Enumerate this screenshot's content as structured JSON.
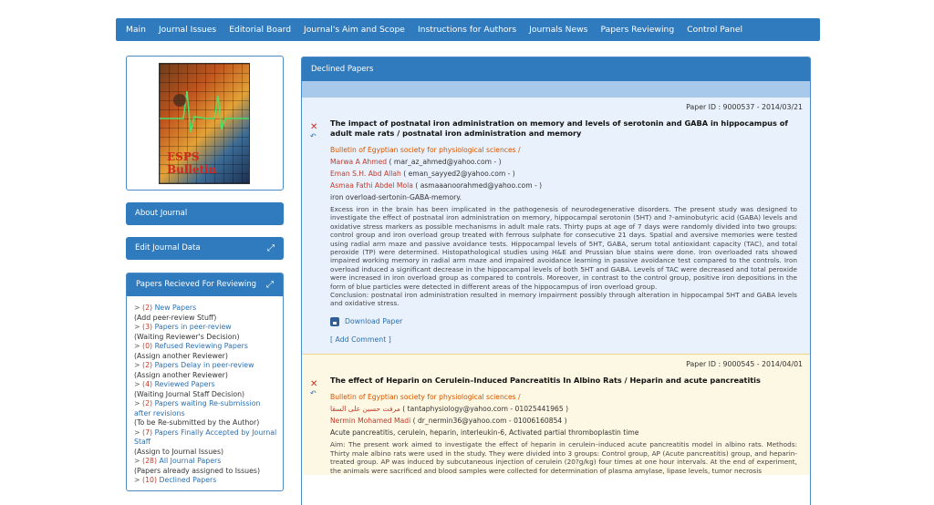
{
  "nav": {
    "items": [
      "Main",
      "Journal Issues",
      "Editorial Board",
      "Journal's Aim and Scope",
      "Instructions for Authors",
      "Journals News",
      "Papers Reviewing",
      "Control Panel"
    ]
  },
  "sidebar": {
    "logo_text": "ESPS Bulletin",
    "about": "About Journal",
    "edit": "Edit Journal Data",
    "panel_title": "Papers Recieved For Reviewing",
    "items": [
      {
        "arrow": ">",
        "count": "(2)",
        "label": "New Papers",
        "sub": "(Add peer-review Stuff)"
      },
      {
        "arrow": ">",
        "count": "(3)",
        "label": "Papers in peer-review",
        "sub": "(Waiting Reviewer's Decision)"
      },
      {
        "arrow": ">",
        "count": "(0)",
        "label": "Refused Reviewing Papers",
        "sub": "(Assign another Reviewer)"
      },
      {
        "arrow": ">",
        "count": "(2)",
        "label": "Papers Delay in peer-review",
        "sub": "(Assign another Reviewer)"
      },
      {
        "arrow": ">",
        "count": "(4)",
        "label": "Reviewed Papers",
        "sub": "(Waiting Journal Staff Decision)"
      },
      {
        "arrow": ">",
        "count": "(2)",
        "label": "Papers waiting Re-submission after revisions",
        "sub": "(To be Re-submitted by the Author)"
      },
      {
        "arrow": ">",
        "count": "(7)",
        "label": "Papers Finally Accepted by Journal Staff",
        "sub": "(Assign to Journal Issues)"
      },
      {
        "arrow": ">",
        "count": "(28)",
        "label": "All Journal Papers",
        "sub": "(Papers already assigned to Issues)"
      },
      {
        "arrow": ">",
        "count": "(10)",
        "label": "Declined Papers",
        "sub": ""
      }
    ]
  },
  "main": {
    "title": "Declined Papers",
    "papers": [
      {
        "pid": "Paper ID : 9000537 - 2014/03/21",
        "title": "The impact of postnatal iron administration on memory and levels of serotonin and GABA in hippocampus of adult male rats / postnatal iron administration and memory",
        "source": "Bulletin of Egyptian society for physiological sciences /",
        "authors": [
          {
            "name": "Marwa A Ahmed",
            "rest": " ( mar_az_ahmed@yahoo.com - )"
          },
          {
            "name": "Eman S.H. Abd Allah",
            "rest": " ( eman_sayyed2@yahoo.com - )"
          },
          {
            "name": "Asmaa Fathi Abdel Mola",
            "rest": " ( asmaaanoorahmed@yahoo.com - )"
          }
        ],
        "keywords": "iron overload-sertonin-GABA-memory.",
        "abstract": "Excess iron in the brain has been implicated in the pathogenesis of neurodegenerative disorders. The present study was designed to investigate the effect of postnatal iron administration on memory, hippocampal serotonin (5HT) and ?-aminobutyric acid (GABA) levels and oxidative stress markers as possible mechanisms in adult male rats. Thirty pups at age of 7 days were randomly divided into two groups: control group and iron overload group treated with ferrous sulphate for consecutive 21 days. Spatial and aversive memories were tested using radial arm maze and passive avoidance tests. Hippocampal levels of 5HT, GABA, serum total antioxidant capacity (TAC), and total peroxide (TP) were determined. Histopathological studies using H&E and Prussian blue stains were done. Iron overloaded rats showed impaired working memory in radial arm maze and impaired avoidance learning in passive avoidance test compared to the controls. Iron overload induced a significant decrease in the hippocampal levels of both 5HT and GABA. Levels of TAC were decreased and total peroxide were increased in iron overload group as compared to controls. Moreover, in contrast to the control group, positive iron depositions in the form of blue particles were detected in different areas of the hippocampus of iron overload group.",
        "conclusion": "Conclusion: postnatal iron administration resulted in memory impairment possibly through alteration in hippocampal 5HT and GABA levels and oxidative stress.",
        "download": "Download Paper",
        "comment": "[ Add Comment ]"
      },
      {
        "pid": "Paper ID : 9000545 - 2014/04/01",
        "title": "The effect of Heparin on Cerulein–Induced Pancreatitis In Albino Rats / Heparin and acute pancreatitis",
        "source": "Bulletin of Egyptian society for physiological sciences /",
        "authors": [
          {
            "name": "مرفت حسين على السقا",
            "rest": " ( tantaphysiology@yahoo.com - 01025441965 )"
          },
          {
            "name": "Nermin Mohamed Madi",
            "rest": " ( dr_nermin36@yahoo.com - 01006160854 )"
          }
        ],
        "keywords": "Acute pancreatitis, cerulein, heparin, interleukin-6, Activated partial thromboplastin time",
        "abstract": "Aim: The present work aimed to investigate the effect of heparin in cerulein–induced acute pancreatitis model in albino rats. Methods: Thirty male albino rats were used in the study. They were divided into 3 groups: Control group, AP (Acute pancreatitis) group, and heparin-treated group. AP was induced by subcutaneous injection of cerulein (20?g/kg) four times at one hour intervals. At the end of experiment, the animals were sacrificed and blood samples were collected for determination of plasma amylase, lipase levels, tumor necrosis",
        "conclusion": "",
        "download": "",
        "comment": ""
      }
    ]
  },
  "colors": {
    "brand": "#2f7bbd",
    "source": "#d35400",
    "author": "#c0392b"
  },
  "icons": [
    "decline-x-icon",
    "restore-icon",
    "download-disk-icon",
    "expand-icon"
  ]
}
